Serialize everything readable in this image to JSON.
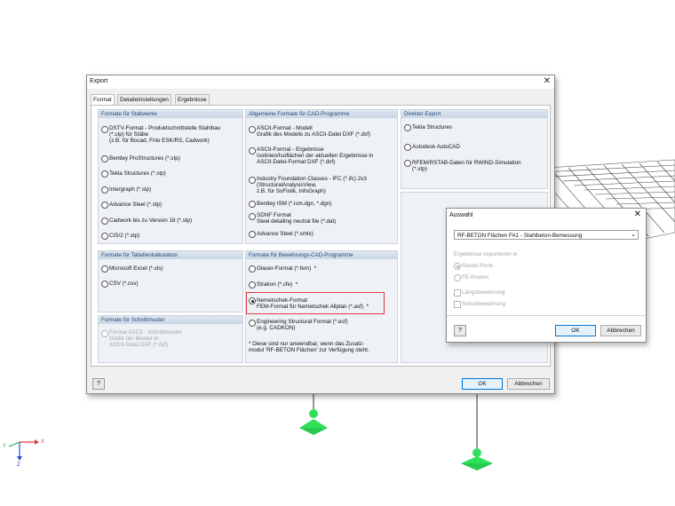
{
  "export_dialog": {
    "title": "Export",
    "close": "✕",
    "tabs": [
      "Format",
      "Detaileinstellungen",
      "Ergebnisse"
    ],
    "groups": {
      "stabwerke": {
        "title": "Formate für Stabwerke",
        "options": [
          "DSTV-Format - Produktschnittstelle Stahlbau\n(*.stp) für Stäbe\n(z.B. für Bocad, Frilo ESK/RS, Cadwork)",
          "Bentley ProStructures (*.stp)",
          "Tekla Structures (*.stp)",
          "Intergraph (*.stp)",
          "Advance Steel (*.stp)",
          "Cadwork bis zu Version 18 (*.stp)",
          "CIS/2 (*.stp)"
        ]
      },
      "tabellen": {
        "title": "Formate für Tabellenkalkulation",
        "options": [
          "Microsoft Excel (*.xls)",
          "CSV (*.csv)"
        ]
      },
      "schnittmuster": {
        "title": "Formate für Schnittmuster",
        "options": [
          "Format ASCII - Schnittmuster\nGrafik der Muster in\nASCII-Datei DXF (*.dxf)"
        ]
      },
      "cad": {
        "title": "Allgemeine Formate für CAD-Programme",
        "options": [
          "ASCII-Format - Modell\nGrafik des Modells zu ASCII-Datei DXF (*.dxf)",
          "ASCII-Format - Ergebnisse\nIsolinien/Isoflächen der aktuellen Ergebnisse in\nASCII-Datei-Format DXF (*.dxf)",
          "Industry Foundation Classes - IFC (*.ifc) 2x3\n(StructuralAnalysisView,\nz.B. für SoFistik, InfoGraph)",
          "Bentley ISM (*.ism.dgn, *.dgn)",
          "SDNF Format\nSteel detailing neutral file (*.dat)",
          "Advance Steel (*.smlx)"
        ]
      },
      "bewehrung": {
        "title": "Formate für Bewehrungs-CAD-Programme",
        "options": [
          "Glaser-Format (*.fem)  *",
          "Strakon (*.cfe)  *",
          "Nemetschek-Format\nFEM-Format für Nemetschek Allplan (*.asf)  *",
          "Engineering Structural Format (*.esf)\n(e.g. CADKON)"
        ],
        "note": "* Diese sind nur anwendbar, wenn das Zusatz-\nmodul 'RF-BETON Flächen' zur Verfügung steht."
      },
      "direkt": {
        "title": "Direkter Export",
        "options": [
          "Tekla Structures",
          "Autodesk AutoCAD",
          "RFEM/RSTAB-Daten für RWIND-Simulation\n(*.vtp)"
        ]
      }
    },
    "help": "?",
    "ok": "OK",
    "cancel": "Abbrechen"
  },
  "auswahl_dialog": {
    "title": "Auswahl",
    "close": "✕",
    "selected_module": "RF-BETON Flächen FA1 - Stahlbeton-Bemessung",
    "export_label": "Ergebnisse exportieren in",
    "radios": [
      "Raster-Punk",
      "FE-Knoten"
    ],
    "checkboxes": [
      "Längsbewehrung",
      "Schubbewehrung"
    ],
    "help": "?",
    "ok": "OK",
    "cancel": "Abbrechen"
  },
  "axis": {
    "x": "X",
    "y": "Y",
    "z": "Z"
  },
  "colors": {
    "accent": "#0078d7",
    "highlight": "#e03c3c",
    "support": "#2fe05a"
  }
}
